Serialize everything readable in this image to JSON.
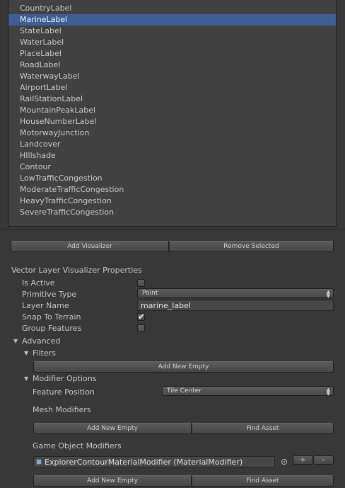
{
  "layer_list": {
    "items": [
      "CountryLabel",
      "MarineLabel",
      "StateLabel",
      "WaterLabel",
      "PlaceLabel",
      "RoadLabel",
      "WaterwayLabel",
      "AirportLabel",
      "RailStationLabel",
      "MountainPeakLabel",
      "HouseNumberLabel",
      "MotorwayJunction",
      "Landcover",
      "HIllshade",
      "Contour",
      "LowTrafficCongestion",
      "ModerateTrafficCongestion",
      "HeavyTrafficCongestion",
      "SevereTrafficCongestion"
    ],
    "selected_index": 1
  },
  "list_buttons": {
    "add": "Add Visualizer",
    "remove": "Remove Selected"
  },
  "properties": {
    "section_title": "Vector Layer Visualizer Properties",
    "is_active_label": "Is Active",
    "is_active": false,
    "primitive_type_label": "Primitive Type",
    "primitive_type_value": "Point",
    "layer_name_label": "Layer Name",
    "layer_name_value": "marine_label",
    "snap_label": "Snap To Terrain",
    "snap_to_terrain": true,
    "group_label": "Group Features",
    "group_features": false
  },
  "advanced": {
    "label": "Advanced",
    "filters_label": "Filters",
    "filters_add": "Add New Empty",
    "modifier_options_label": "Modifier Options",
    "feature_position_label": "Feature Position",
    "feature_position_value": "Tile Center",
    "mesh_modifiers_label": "Mesh Modifiers",
    "mesh_add": "Add New Empty",
    "mesh_find": "Find Asset",
    "gameobject_modifiers_label": "Game Object Modifiers",
    "gameobject_item": "ExplorerContourMaterialModifier (MaterialModifier)",
    "plus": "+",
    "minus": "-",
    "go_add": "Add New Empty",
    "go_find": "Find Asset"
  }
}
